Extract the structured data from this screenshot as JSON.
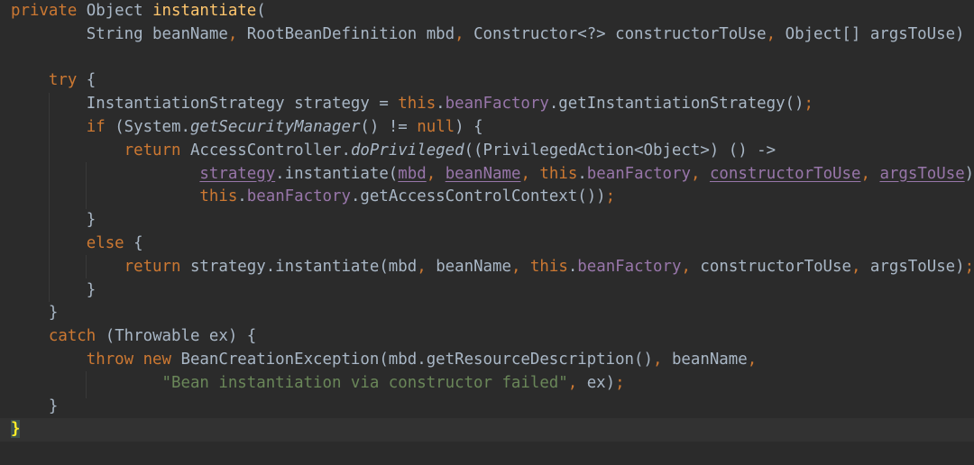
{
  "editor": {
    "colors": {
      "background": "#2b2b2b",
      "keyword": "#cc7832",
      "method_declaration": "#ffc66d",
      "field": "#9876aa",
      "string": "#6a8759",
      "default_text": "#a9b7c6",
      "brace_highlight": "#ffef28"
    },
    "lines": [
      [
        {
          "text": "private",
          "cls": "kw"
        },
        {
          "text": " Object "
        },
        {
          "text": "instantiate",
          "cls": "fn"
        },
        {
          "text": "("
        }
      ],
      [
        {
          "text": "        String beanName"
        },
        {
          "text": ",",
          "cls": "punct"
        },
        {
          "text": " RootBeanDefinition mbd"
        },
        {
          "text": ",",
          "cls": "punct"
        },
        {
          "text": " Constructor<?> constructorToUse"
        },
        {
          "text": ",",
          "cls": "punct"
        },
        {
          "text": " Object[] argsToUse) "
        },
        {
          "text": "{",
          "cls": "brace-match"
        }
      ],
      [],
      [
        {
          "text": "    "
        },
        {
          "text": "try",
          "cls": "kw"
        },
        {
          "text": " {"
        }
      ],
      [
        {
          "text": "        InstantiationStrategy strategy = "
        },
        {
          "text": "this",
          "cls": "kw"
        },
        {
          "text": "."
        },
        {
          "text": "beanFactory",
          "cls": "fld"
        },
        {
          "text": ".getInstantiationStrategy()"
        },
        {
          "text": ";",
          "cls": "punct"
        }
      ],
      [
        {
          "text": "        "
        },
        {
          "text": "if",
          "cls": "kw"
        },
        {
          "text": " (System."
        },
        {
          "text": "getSecurityManager",
          "cls": "ital"
        },
        {
          "text": "() != "
        },
        {
          "text": "null",
          "cls": "kw"
        },
        {
          "text": ") {"
        }
      ],
      [
        {
          "text": "            "
        },
        {
          "text": "return",
          "cls": "kw"
        },
        {
          "text": " AccessController."
        },
        {
          "text": "doPrivileged",
          "cls": "ital"
        },
        {
          "text": "((PrivilegedAction<Object>) () ->"
        }
      ],
      [
        {
          "text": "                    "
        },
        {
          "text": "strategy",
          "cls": "fld ul"
        },
        {
          "text": ".instantiate("
        },
        {
          "text": "mbd",
          "cls": "fld ul"
        },
        {
          "text": ",",
          "cls": "punct"
        },
        {
          "text": " "
        },
        {
          "text": "beanName",
          "cls": "fld ul"
        },
        {
          "text": ",",
          "cls": "punct"
        },
        {
          "text": " "
        },
        {
          "text": "this",
          "cls": "kw"
        },
        {
          "text": "."
        },
        {
          "text": "beanFactory",
          "cls": "fld"
        },
        {
          "text": ",",
          "cls": "punct"
        },
        {
          "text": " "
        },
        {
          "text": "constructorToUse",
          "cls": "fld ul"
        },
        {
          "text": ",",
          "cls": "punct"
        },
        {
          "text": " "
        },
        {
          "text": "argsToUse",
          "cls": "fld ul"
        },
        {
          "text": ")"
        },
        {
          "text": ",",
          "cls": "punct"
        }
      ],
      [
        {
          "text": "                    "
        },
        {
          "text": "this",
          "cls": "kw"
        },
        {
          "text": "."
        },
        {
          "text": "beanFactory",
          "cls": "fld"
        },
        {
          "text": ".getAccessControlContext())"
        },
        {
          "text": ";",
          "cls": "punct"
        }
      ],
      [
        {
          "text": "        }"
        }
      ],
      [
        {
          "text": "        "
        },
        {
          "text": "else",
          "cls": "kw"
        },
        {
          "text": " {"
        }
      ],
      [
        {
          "text": "            "
        },
        {
          "text": "return",
          "cls": "kw"
        },
        {
          "text": " strategy.instantiate(mbd"
        },
        {
          "text": ",",
          "cls": "punct"
        },
        {
          "text": " beanName"
        },
        {
          "text": ",",
          "cls": "punct"
        },
        {
          "text": " "
        },
        {
          "text": "this",
          "cls": "kw"
        },
        {
          "text": "."
        },
        {
          "text": "beanFactory",
          "cls": "fld"
        },
        {
          "text": ",",
          "cls": "punct"
        },
        {
          "text": " constructorToUse"
        },
        {
          "text": ",",
          "cls": "punct"
        },
        {
          "text": " argsToUse)"
        },
        {
          "text": ";",
          "cls": "punct"
        }
      ],
      [
        {
          "text": "        }"
        }
      ],
      [
        {
          "text": "    }"
        }
      ],
      [
        {
          "text": "    "
        },
        {
          "text": "catch",
          "cls": "kw"
        },
        {
          "text": " (Throwable ex) {"
        }
      ],
      [
        {
          "text": "        "
        },
        {
          "text": "throw new",
          "cls": "kw"
        },
        {
          "text": " BeanCreationException(mbd.getResourceDescription()"
        },
        {
          "text": ",",
          "cls": "punct"
        },
        {
          "text": " beanName"
        },
        {
          "text": ",",
          "cls": "punct"
        }
      ],
      [
        {
          "text": "                "
        },
        {
          "text": "\"Bean instantiation via constructor failed\"",
          "cls": "str"
        },
        {
          "text": ",",
          "cls": "punct"
        },
        {
          "text": " ex)"
        },
        {
          "text": ";",
          "cls": "punct"
        }
      ],
      [
        {
          "text": "    }"
        }
      ],
      [
        {
          "text": "}",
          "cls": "brace-match"
        }
      ]
    ]
  }
}
